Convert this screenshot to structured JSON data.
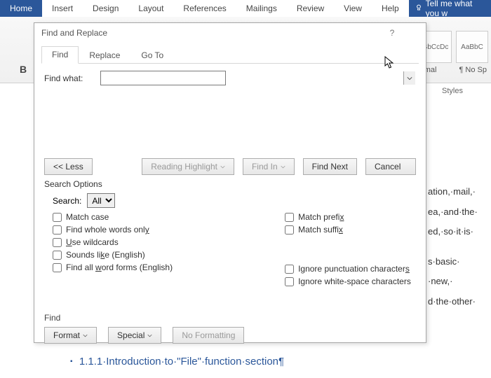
{
  "ribbon": {
    "tabs": [
      "Home",
      "Insert",
      "Design",
      "Layout",
      "References",
      "Mailings",
      "Review",
      "View",
      "Help"
    ],
    "tell_me": "Tell me what you w",
    "style_boxes": [
      "BbCcDc",
      "AaBbC"
    ],
    "style_labels": [
      "Normal",
      "¶ No Sp"
    ],
    "styles_section": "Styles",
    "bold": "B"
  },
  "dialog": {
    "title": "Find and Replace",
    "help": "?",
    "tabs": {
      "find": "Find",
      "replace": "Replace",
      "goto": "Go To"
    },
    "find_what_label": "Find what:",
    "find_what_value": "",
    "buttons": {
      "less": "<< Less",
      "reading_highlight": "Reading Highlight",
      "find_in": "Find In",
      "find_next": "Find Next",
      "cancel": "Cancel"
    },
    "search_options_label": "Search Options",
    "search_label": "Search:",
    "search_direction": "All",
    "options_left": [
      {
        "pre": "",
        "ul": "",
        "post": "Match case"
      },
      {
        "pre": "Find whole words onl",
        "ul": "y",
        "post": ""
      },
      {
        "pre": "",
        "ul": "U",
        "post": "se wildcards"
      },
      {
        "pre": "Sounds li",
        "ul": "k",
        "post": "e (English)"
      },
      {
        "pre": "Find all ",
        "ul": "w",
        "post": "ord forms (English)"
      }
    ],
    "options_right": [
      {
        "pre": "Match prefi",
        "ul": "x",
        "post": ""
      },
      {
        "pre": "Match suffi",
        "ul": "x",
        "post": ""
      },
      {
        "pre": "Ignore punctuation character",
        "ul": "s",
        "post": ""
      },
      {
        "pre": "Ignore white-space characters",
        "ul": "",
        "post": ""
      }
    ],
    "footer": {
      "label": "Find",
      "format": "Format",
      "special": "Special",
      "no_formatting": "No Formatting"
    }
  },
  "document": {
    "frag1": "ation,·mail,·",
    "frag2": "ea,·and·the·",
    "frag3": "ed,·so·it·is·",
    "frag4": "s·basic·",
    "frag5": "·new,·",
    "frag6": "d·the·other·",
    "heading_bullet": "▪",
    "heading": "1.1.1·Introduction·to·\"File\"·function·section¶"
  }
}
